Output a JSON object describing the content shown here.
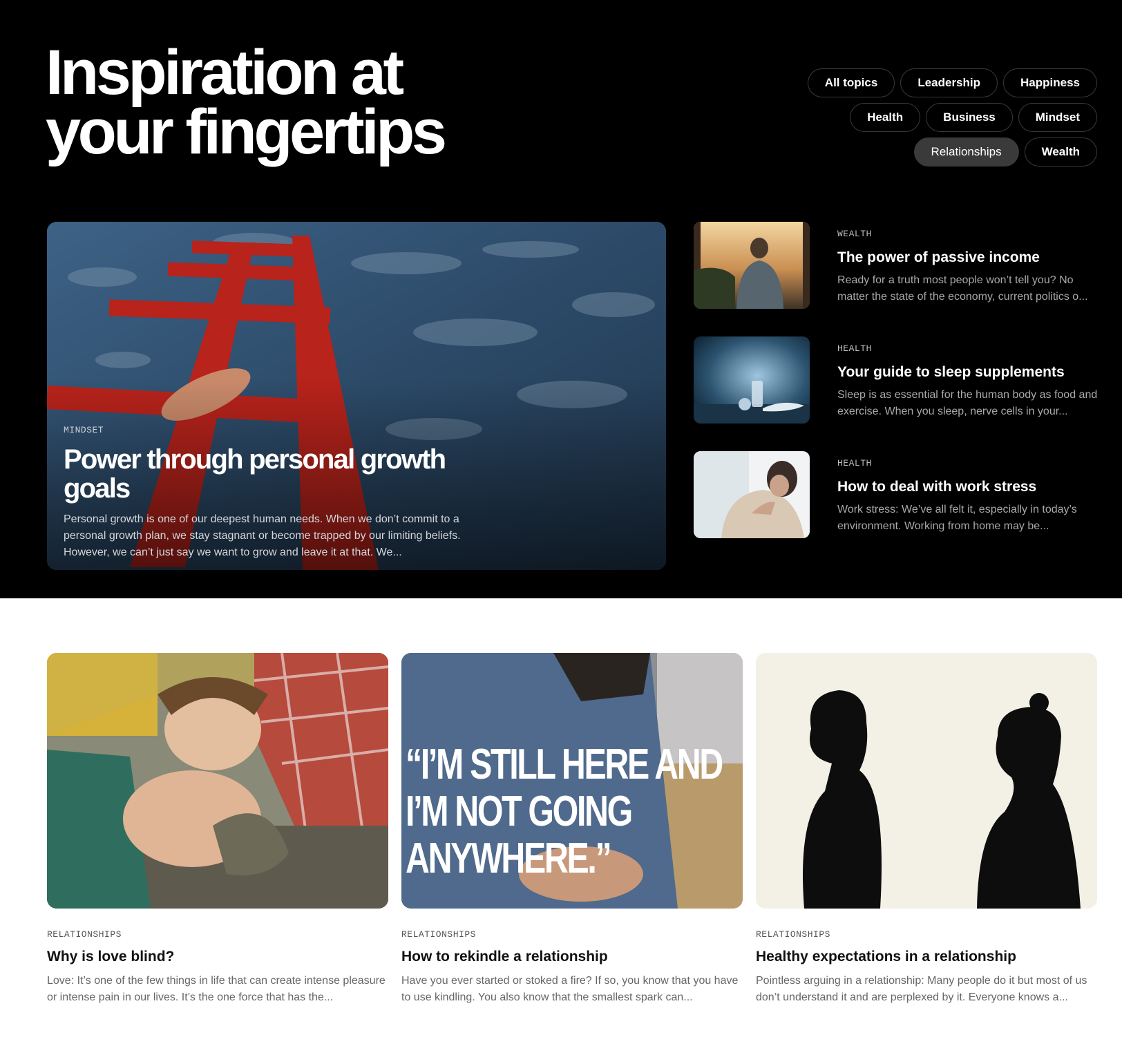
{
  "hero": {
    "title_line1": "Inspiration at",
    "title_line2": "your fingertips"
  },
  "topics": [
    {
      "label": "All topics",
      "active": false
    },
    {
      "label": "Leadership",
      "active": false
    },
    {
      "label": "Happiness",
      "active": false
    },
    {
      "label": "Health",
      "active": false
    },
    {
      "label": "Business",
      "active": false
    },
    {
      "label": "Mindset",
      "active": false
    },
    {
      "label": "Relationships",
      "active": true
    },
    {
      "label": "Wealth",
      "active": false
    }
  ],
  "featured": {
    "category": "MINDSET",
    "title": "Power through personal growth goals",
    "description": "Personal growth is one of our deepest human needs. When we don’t commit to a personal growth plan, we stay stagnant or become trapped by our limiting beliefs. However, we can’t just say we want to grow and leave it at that. We..."
  },
  "side_articles": [
    {
      "category": "WEALTH",
      "title": "The power of passive income",
      "description": "Ready for a truth most people won’t tell you? No matter the state of the economy, current politics o..."
    },
    {
      "category": "HEALTH",
      "title": "Your guide to sleep supplements",
      "description": "Sleep is as essential for the human body as food and exercise. When you sleep, nerve cells in your..."
    },
    {
      "category": "HEALTH",
      "title": "How to deal with work stress",
      "description": "Work stress: We’ve all felt it, especially in today’s environment. Working from home may be..."
    }
  ],
  "cards": [
    {
      "category": "RELATIONSHIPS",
      "title": "Why is love blind?",
      "description": "Love: It’s one of the few things in life that can create intense pleasure or intense pain in our lives. It’s the one force that has the..."
    },
    {
      "category": "RELATIONSHIPS",
      "title": "How to rekindle a relationship",
      "description": "Have you ever started or stoked a fire? If so, you know that you have to use kindling. You also know that the smallest spark can...",
      "image_quote": "“I’M STILL HERE AND I’M NOT GOING ANYWHERE.”"
    },
    {
      "category": "RELATIONSHIPS",
      "title": "Healthy expectations in a relationship",
      "description": "Pointless arguing in a relationship: Many people do it but most of us don’t understand it and are perplexed by it. Everyone knows a..."
    }
  ]
}
